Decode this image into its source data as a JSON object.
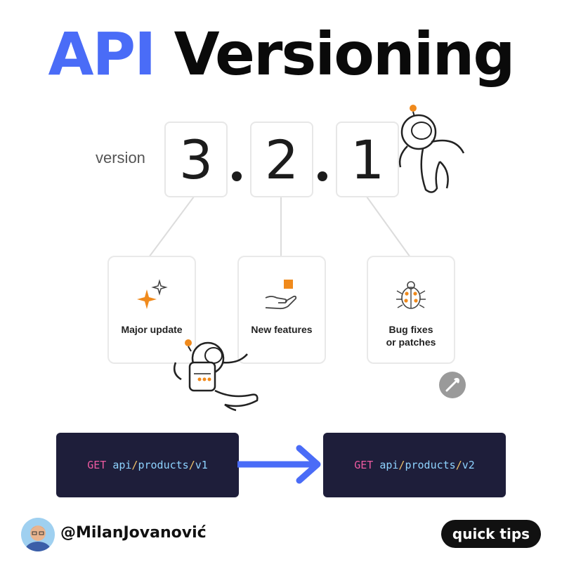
{
  "title": {
    "accent": "API",
    "rest": "Versioning"
  },
  "version": {
    "label": "version",
    "digits": [
      "3",
      "2",
      "1"
    ]
  },
  "cards": [
    {
      "label": "Major update",
      "icon": "sparkle-icon"
    },
    {
      "label": "New features",
      "icon": "hand-gift-icon"
    },
    {
      "label_line1": "Bug fixes",
      "label_line2": "or patches",
      "icon": "ladybug-icon"
    }
  ],
  "code": {
    "left": {
      "method": "GET",
      "seg1": "api",
      "sep1": "/",
      "seg2": "products",
      "sep2": "/",
      "seg3": "v1"
    },
    "right": {
      "method": "GET",
      "seg1": "api",
      "sep1": "/",
      "seg2": "products",
      "sep2": "/",
      "seg3": "v2"
    }
  },
  "footer": {
    "handle": "@MilanJovanović",
    "badge": "quick tips"
  },
  "colors": {
    "accent": "#4a6cf7",
    "code_bg": "#1e1e3a",
    "orange": "#f08a1c"
  }
}
